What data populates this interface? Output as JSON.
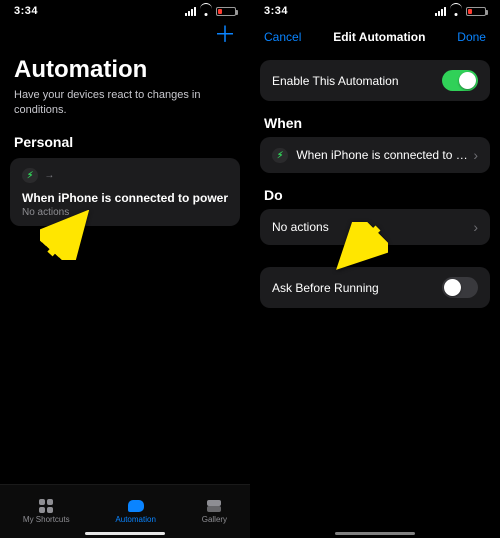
{
  "statusbar": {
    "time": "3:34"
  },
  "left": {
    "add_glyph": "＋",
    "title": "Automation",
    "subtitle": "Have your devices react to changes in conditions.",
    "section": "Personal",
    "card": {
      "badge_glyph": "⚡︎",
      "title": "When iPhone is connected to power",
      "subtitle": "No actions"
    },
    "tabs": {
      "shortcuts": "My Shortcuts",
      "automation": "Automation",
      "gallery": "Gallery"
    }
  },
  "right": {
    "cancel": "Cancel",
    "title": "Edit Automation",
    "done": "Done",
    "enable_label": "Enable This Automation",
    "when_head": "When",
    "when_row": "When iPhone is connected to power",
    "when_badge_glyph": "⚡︎",
    "do_head": "Do",
    "do_row": "No actions",
    "ask_label": "Ask Before Running"
  }
}
